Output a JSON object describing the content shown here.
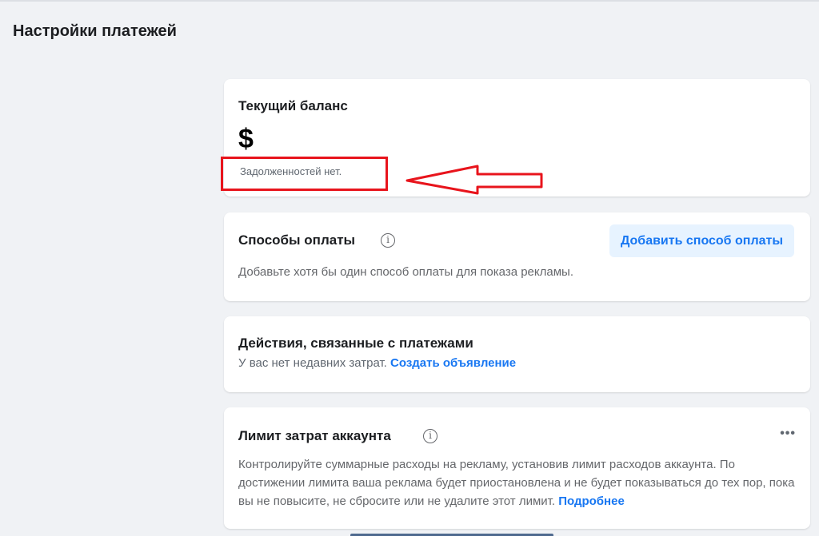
{
  "page": {
    "title": "Настройки платежей"
  },
  "balance_card": {
    "title": "Текущий баланс",
    "value": "$",
    "status": "Задолженностей нет."
  },
  "payment_methods": {
    "title": "Способы оплаты",
    "add_button": "Добавить способ оплаты",
    "description": "Добавьте хотя бы один способ оплаты для показа рекламы."
  },
  "payment_activity": {
    "title": "Действия, связанные с платежами",
    "text": "У вас нет недавних затрат.",
    "link": "Создать объявление"
  },
  "spending_limit": {
    "title": "Лимит затрат аккаунта",
    "description": "Контролируйте суммарные расходы на рекламу, установив лимит расходов аккаунта. По достижении лимита ваша реклама будет приостановлена и не будет показываться до тех пор, пока вы не повысите, не сбросите или не удалите этот лимит.",
    "link": "Подробнее"
  },
  "icons": {
    "info": "info-icon",
    "more": "more-options-icon"
  },
  "colors": {
    "link": "#1877f2",
    "button_bg": "#e7f3ff",
    "annotation": "#e8141c",
    "background": "#f0f2f5"
  }
}
